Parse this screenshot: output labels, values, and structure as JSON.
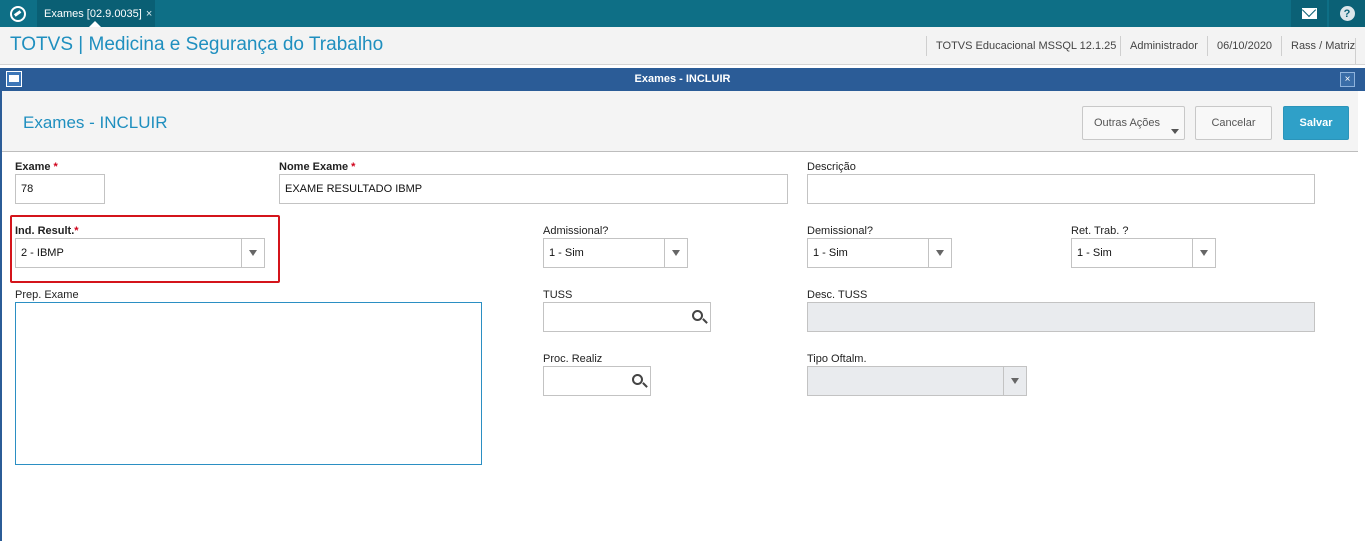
{
  "topbar": {
    "tab_label": "Exames [02.9.0035]",
    "tab_close": "×",
    "help_glyph": "?"
  },
  "header": {
    "app_title": "TOTVS | Medicina e Segurança do Trabalho",
    "environment": "TOTVS Educacional MSSQL 12.1.25",
    "user": "Administrador",
    "date": "06/10/2020",
    "branch": "Rass / Matriz"
  },
  "window": {
    "title": "Exames - INCLUIR",
    "close_glyph": "×"
  },
  "form": {
    "title": "Exames - INCLUIR",
    "actions": {
      "other_label": "Outras Ações",
      "cancel_label": "Cancelar",
      "save_label": "Salvar"
    },
    "required_mark": "*",
    "fields": {
      "exame": {
        "label": "Exame",
        "value": "78"
      },
      "nome_exame": {
        "label": "Nome Exame",
        "value": "EXAME RESULTADO IBMP"
      },
      "descricao": {
        "label": "Descrição",
        "value": ""
      },
      "ind_result": {
        "label": "Ind. Result.",
        "value": "2 - IBMP"
      },
      "admissional": {
        "label": "Admissional?",
        "value": "1 - Sim"
      },
      "demissional": {
        "label": "Demissional?",
        "value": "1 - Sim"
      },
      "ret_trab": {
        "label": "Ret. Trab. ?",
        "value": "1 - Sim"
      },
      "prep_exame": {
        "label": "Prep. Exame",
        "value": ""
      },
      "tuss": {
        "label": "TUSS",
        "value": ""
      },
      "desc_tuss": {
        "label": "Desc. TUSS",
        "value": ""
      },
      "proc_realiz": {
        "label": "Proc. Realiz",
        "value": ""
      },
      "tipo_oftalm": {
        "label": "Tipo Oftalm.",
        "value": ""
      }
    }
  },
  "colors": {
    "topbar": "#0e6f86",
    "accent": "#1f8fbf",
    "window_title": "#2b5c97",
    "save_button": "#2fa0c8",
    "highlight": "#d4141b",
    "required": "#d0021b"
  }
}
